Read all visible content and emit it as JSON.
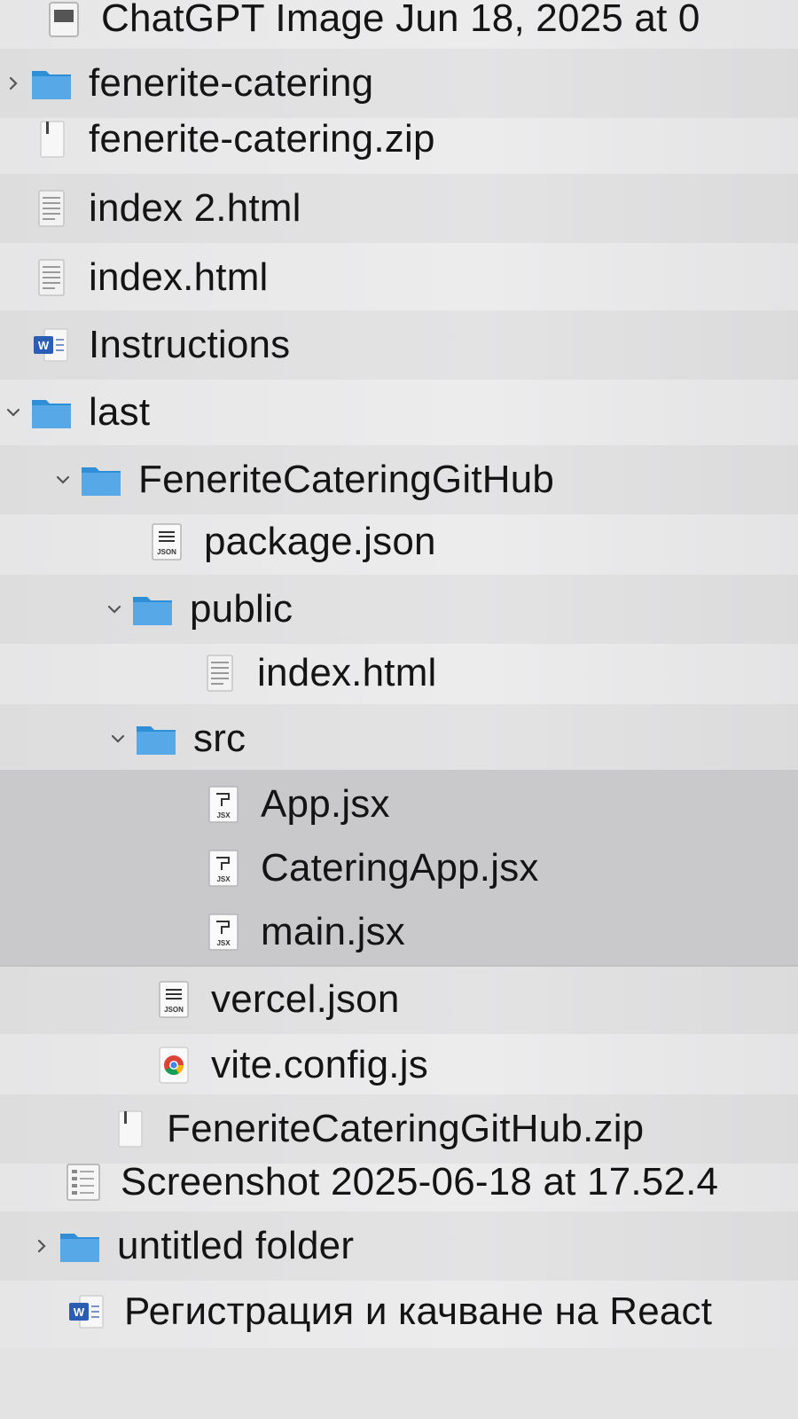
{
  "rows": [
    {
      "label": "ChatGPT Image Jun 18, 2025 at 0"
    },
    {
      "label": "fenerite-catering"
    },
    {
      "label": "fenerite-catering.zip"
    },
    {
      "label": "index 2.html"
    },
    {
      "label": "index.html"
    },
    {
      "label": "Instructions"
    },
    {
      "label": "last"
    },
    {
      "label": "FeneriteCateringGitHub"
    },
    {
      "label": "package.json"
    },
    {
      "label": "public"
    },
    {
      "label": "index.html"
    },
    {
      "label": "src"
    },
    {
      "label": "App.jsx"
    },
    {
      "label": "CateringApp.jsx"
    },
    {
      "label": "main.jsx"
    },
    {
      "label": "vercel.json"
    },
    {
      "label": "vite.config.js"
    },
    {
      "label": "FeneriteCateringGitHub.zip"
    },
    {
      "label": "Screenshot 2025-06-18 at 17.52.4"
    },
    {
      "label": "untitled folder"
    },
    {
      "label": "Регистрация и качване на React"
    }
  ],
  "colors": {
    "folder": "#2e8fd6",
    "folder_tab": "#56a9e6",
    "selection": "#c9c9cb",
    "word": "#2b5db5"
  },
  "icons": {
    "folder": "folder-icon",
    "zip": "zip-archive-icon",
    "html": "html-document-icon",
    "word": "word-document-icon",
    "json": "json-file-icon",
    "jsx": "jsx-file-icon",
    "chrome": "chrome-icon",
    "image": "image-file-icon",
    "chevron_right": "chevron-right-icon",
    "chevron_down": "chevron-down-icon"
  }
}
